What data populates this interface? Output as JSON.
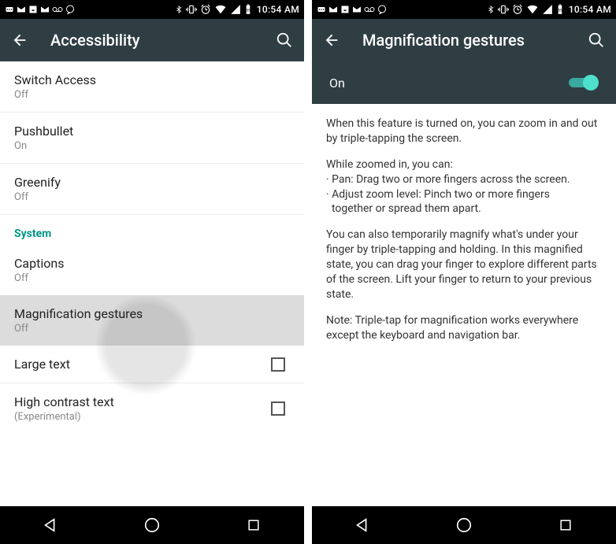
{
  "status": {
    "time": "10:54 AM"
  },
  "left": {
    "title": "Accessibility",
    "items": {
      "switch_access": {
        "label": "Switch Access",
        "status": "Off"
      },
      "pushbullet": {
        "label": "Pushbullet",
        "status": "On"
      },
      "greenify": {
        "label": "Greenify",
        "status": "Off"
      }
    },
    "section_system": "System",
    "system_items": {
      "captions": {
        "label": "Captions",
        "status": "Off"
      },
      "magnification": {
        "label": "Magnification gestures",
        "status": "Off"
      },
      "large_text": {
        "label": "Large text"
      },
      "high_contrast": {
        "label": "High contrast text",
        "sub": "(Experimental)"
      }
    }
  },
  "right": {
    "title": "Magnification gestures",
    "switch_label": "On",
    "desc_p1": "When this feature is turned on, you can zoom in and out by triple-tapping the screen.",
    "desc_p2_intro": "While zoomed in, you can:",
    "desc_p2_b1": "· Pan: Drag two or more fingers across the screen.",
    "desc_p2_b2": "· Adjust zoom level: Pinch two or more fingers",
    "desc_p2_b2b": "  together or spread them apart.",
    "desc_p3": "You can also temporarily magnify what's under your finger by triple-tapping and holding. In this magnified state, you can drag your finger to explore different parts of the screen. Lift your finger to return to your previous state.",
    "desc_p4": "Note: Triple-tap for magnification works everywhere except the keyboard and navigation bar."
  }
}
